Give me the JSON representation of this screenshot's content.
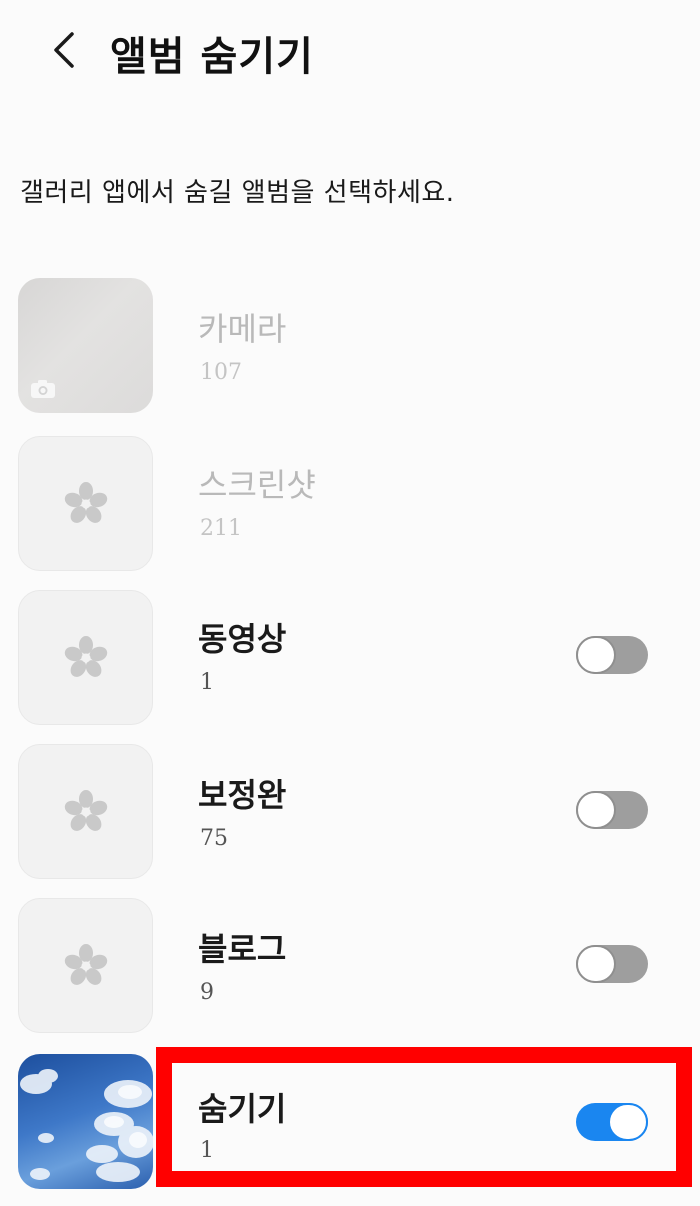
{
  "header": {
    "title": "앨범 숨기기"
  },
  "description": "갤러리 앱에서 숨길 앨범을 선택하세요.",
  "albums": [
    {
      "name": "카메라",
      "count": "107",
      "enabled": false,
      "toggle": null,
      "thumbnail": "camera-icon"
    },
    {
      "name": "스크린샷",
      "count": "211",
      "enabled": false,
      "toggle": null,
      "thumbnail": "flower-icon"
    },
    {
      "name": "동영상",
      "count": "1",
      "enabled": true,
      "toggle": "off",
      "thumbnail": "flower-icon"
    },
    {
      "name": "보정완",
      "count": "75",
      "enabled": true,
      "toggle": "off",
      "thumbnail": "flower-icon"
    },
    {
      "name": "블로그",
      "count": "9",
      "enabled": true,
      "toggle": "off",
      "thumbnail": "flower-icon"
    },
    {
      "name": "숨기기",
      "count": "1",
      "enabled": true,
      "toggle": "on",
      "thumbnail": "sky-photo"
    }
  ],
  "colors": {
    "toggle_on": "#1a86f0",
    "toggle_off": "#9e9e9e",
    "highlight": "#ff0000"
  }
}
